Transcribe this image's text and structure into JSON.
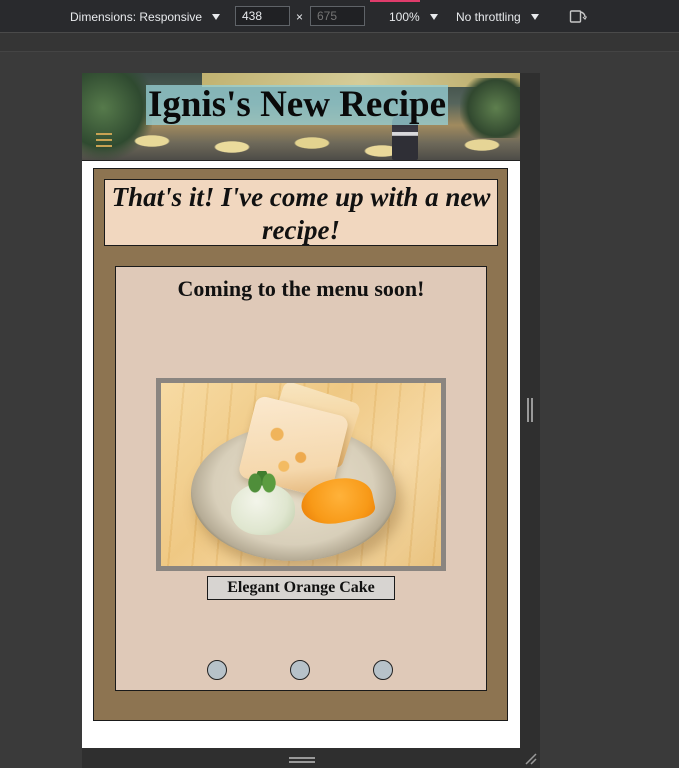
{
  "devtools": {
    "dimensions_label": "Dimensions: Responsive",
    "width_value": "438",
    "height_placeholder": "675",
    "times_sign": "×",
    "zoom_label": "100%",
    "throttling_label": "No throttling",
    "icons": [
      "caret-down-icon",
      "rotate-icon",
      "resize-grip-icon"
    ]
  },
  "page": {
    "banner": {
      "title": "Ignis's New Recipe",
      "menu_icon": "hamburger-icon"
    },
    "quote": "That's it! I've come up with a new recipe!",
    "card": {
      "heading": "Coming to the menu soon!",
      "dish_name": "Elegant Orange Cake",
      "carousel_dots": [
        "1",
        "2",
        "3"
      ]
    }
  },
  "colors": {
    "panel_brown": "#8d7451",
    "quote_bg": "#f1d7bf",
    "card_bg": "#dfc9b8",
    "title_highlight": "#96ced4",
    "dot": "#b7c2c9",
    "devtools_bg": "#292a2d"
  }
}
